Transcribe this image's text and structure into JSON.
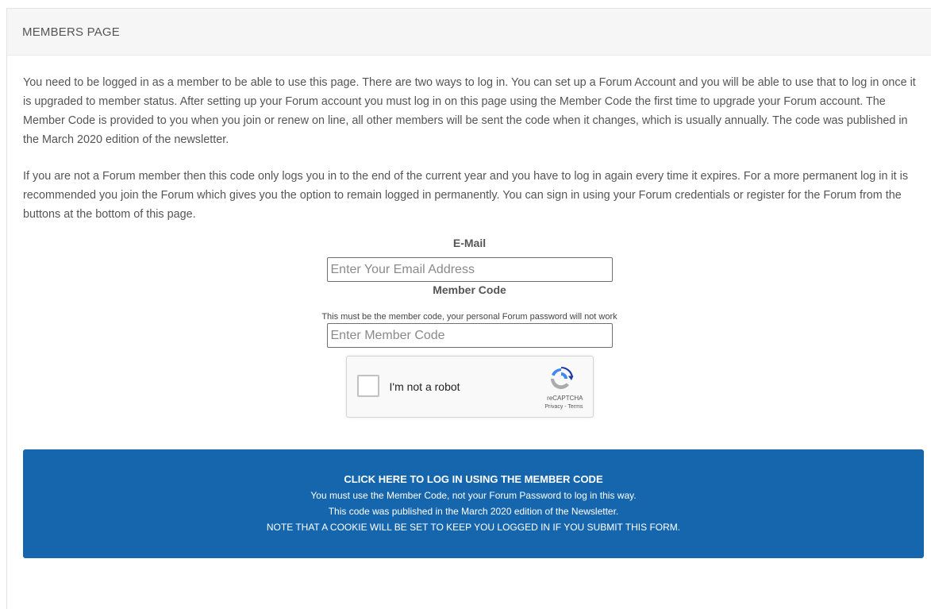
{
  "panel": {
    "title": "MEMBERS PAGE"
  },
  "intro": {
    "paragraph1": "You need to be logged in as a member to be able to use this page. There are two ways to log in. You can set up a Forum Account and you will be able to use that to log in once it is upgraded to member status. After setting up your Forum account you must log in on this page using the Member Code the first time to upgrade your Forum account. The Member Code is provided to you when you join or renew on line, all other members will be sent the code when it changes, which is usually annually. The code was published in the March 2020 edition of the newsletter.",
    "paragraph2": "If you are not a Forum member then this code only logs you in to the end of the current year and you have to log in again every time it expires. For a more permanent log in it is recommended you join the Forum which gives you the option to remain logged in permanently. You can sign in using your Forum credentials or register for the Forum from the buttons at the bottom of this page."
  },
  "form": {
    "email_label": "E-Mail",
    "email_placeholder": "Enter Your Email Address",
    "email_value": "",
    "code_label": "Member Code",
    "code_hint": "This must be the member code, your personal Forum password will not work",
    "code_placeholder": "Enter Member Code",
    "code_value": ""
  },
  "captcha": {
    "label": "I'm not a robot",
    "brand": "reCAPTCHA",
    "terms": "Privacy - Terms",
    "checked": false,
    "icon": "recaptcha-logo-icon"
  },
  "login_button": {
    "line1": "CLICK HERE TO LOG IN USING THE MEMBER CODE",
    "line2": "You must use the Member Code, not your Forum Password to log in this way.",
    "line3": "This code was published in the March 2020 edition of the Newsletter.",
    "line4": "NOTE THAT A COOKIE WILL BE SET TO KEEP YOU LOGGED IN IF YOU SUBMIT THIS FORM.",
    "color": "#1566ad"
  }
}
